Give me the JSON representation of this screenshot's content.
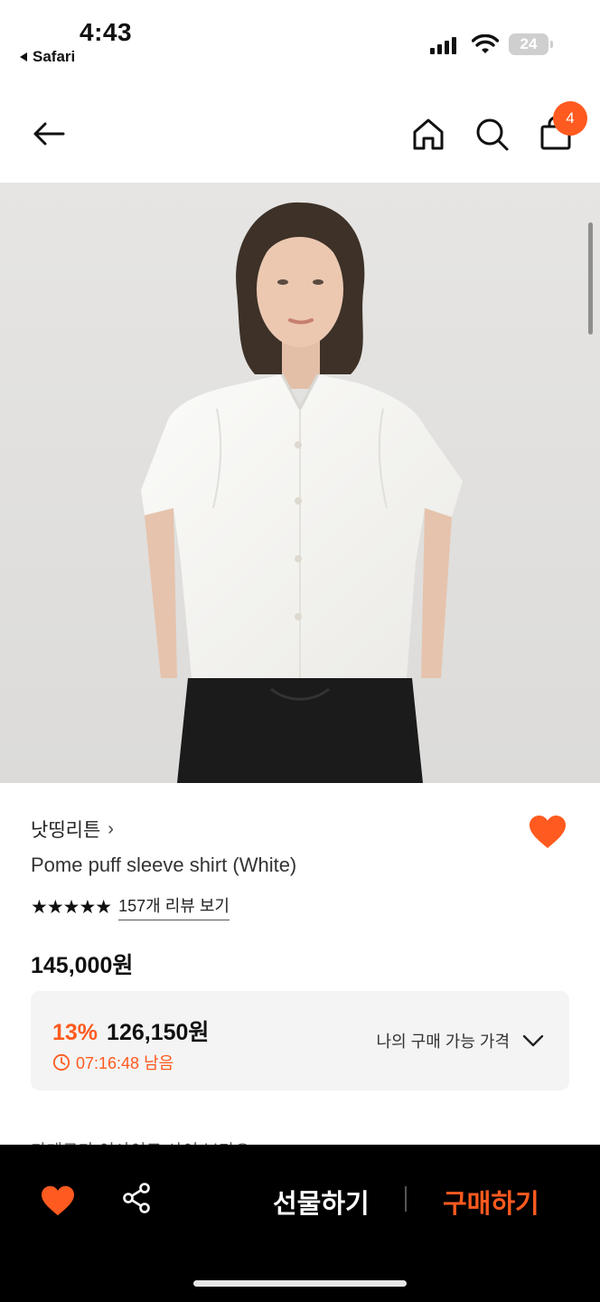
{
  "status": {
    "time": "4:43",
    "back_app": "Safari",
    "battery": "24"
  },
  "header": {
    "cart_count": "4"
  },
  "product": {
    "brand": "낫띵리튼",
    "brand_chevron": "›",
    "name": "Pome puff sleeve shirt (White)",
    "stars": "★★★★★",
    "rating_value": 5,
    "review_link": "157개 리뷰 보기",
    "price": "145,000원",
    "discount_rate": "13%",
    "discount_price": "126,150원",
    "timer": "07:16:48 남음",
    "my_price_label": "나의 구매 가능 가격",
    "peek_text": "가게구가    이사이로  사이  보다요"
  },
  "bottom_bar": {
    "gift_label": "선물하기",
    "buy_label": "구매하기"
  },
  "colors": {
    "accent": "#ff5a1f",
    "bar_bg": "#000000"
  },
  "icons": [
    "back-arrow-icon",
    "home-icon",
    "search-icon",
    "cart-icon",
    "heart-icon",
    "share-icon",
    "clock-icon",
    "chevron-down-icon"
  ]
}
